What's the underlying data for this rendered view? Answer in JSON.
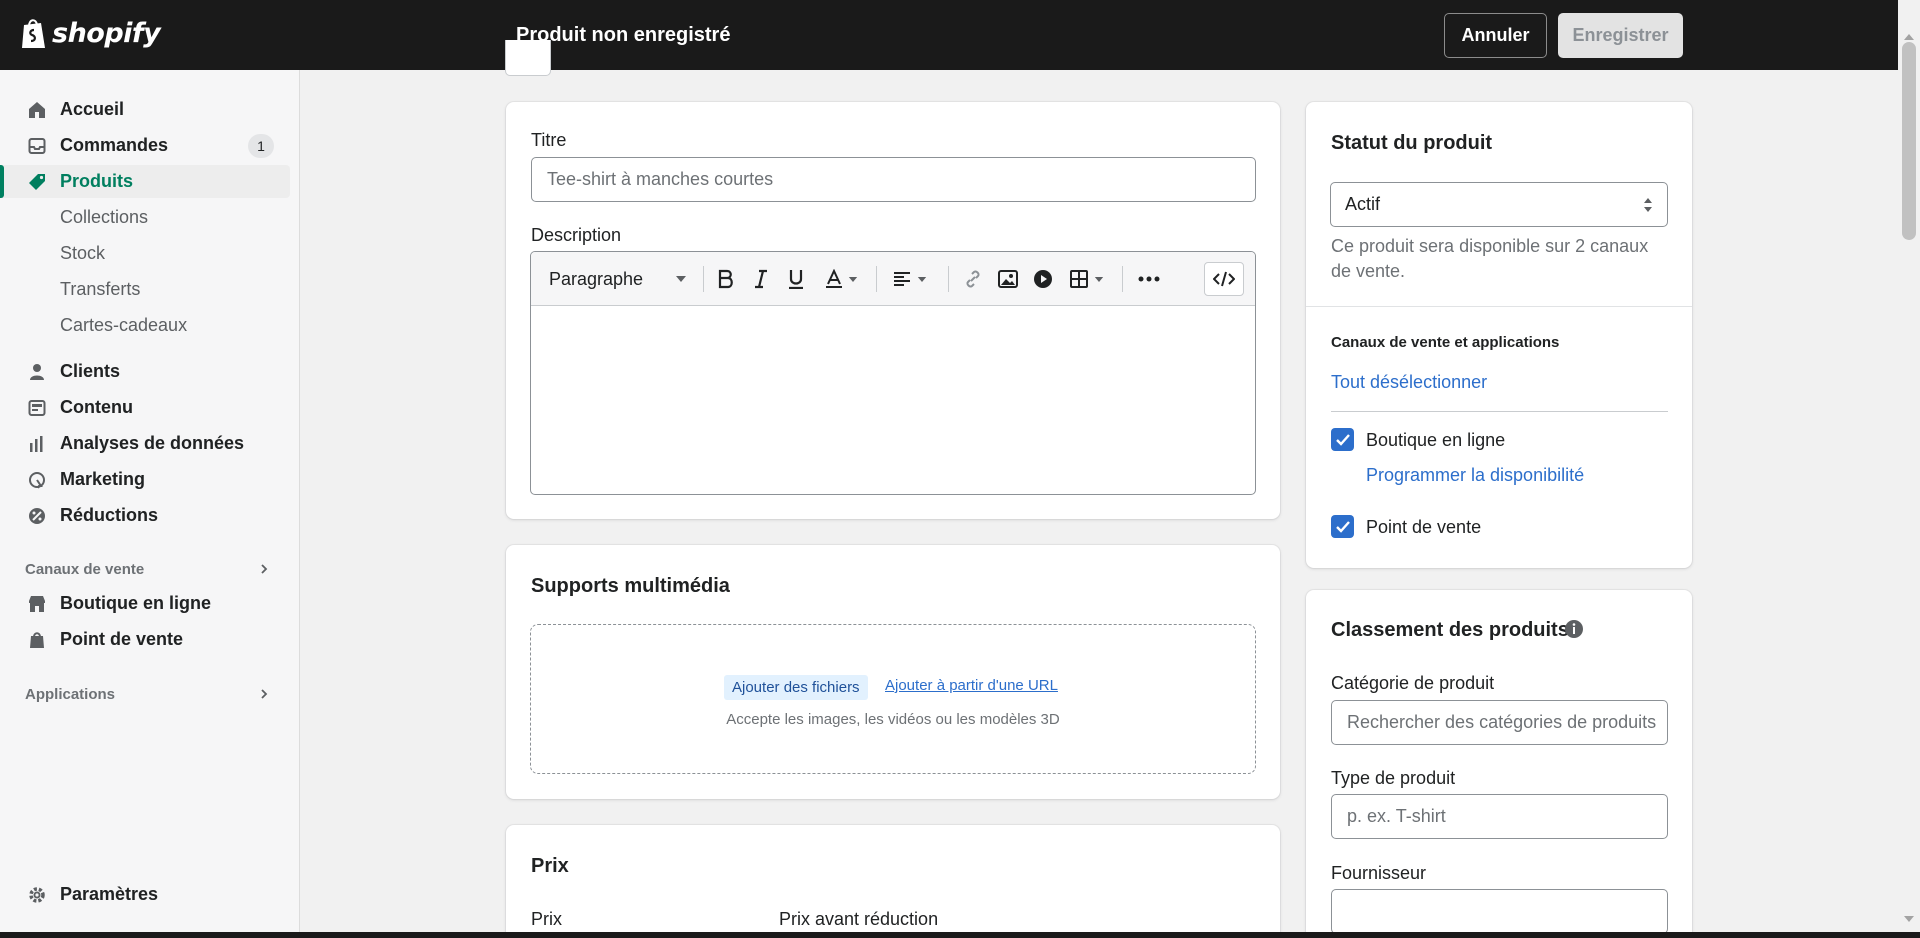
{
  "brand": {
    "name": "shopify",
    "accent": "#008060"
  },
  "header": {
    "title": "Produit non enregistré",
    "cancel_label": "Annuler",
    "save_label": "Enregistrer"
  },
  "sidebar": {
    "items": [
      {
        "label": "Accueil",
        "icon": "home-icon"
      },
      {
        "label": "Commandes",
        "icon": "inbox-icon",
        "badge": "1"
      },
      {
        "label": "Produits",
        "icon": "tag-icon",
        "active": true
      },
      {
        "label": "Collections"
      },
      {
        "label": "Stock"
      },
      {
        "label": "Transferts"
      },
      {
        "label": "Cartes-cadeaux"
      },
      {
        "label": "Clients",
        "icon": "person-icon"
      },
      {
        "label": "Contenu",
        "icon": "content-icon"
      },
      {
        "label": "Analyses de données",
        "icon": "analytics-icon"
      },
      {
        "label": "Marketing",
        "icon": "marketing-icon"
      },
      {
        "label": "Réductions",
        "icon": "discount-icon"
      }
    ],
    "sales_channels_label": "Canaux de vente",
    "channels": [
      {
        "label": "Boutique en ligne",
        "icon": "store-icon"
      },
      {
        "label": "Point de vente",
        "icon": "pos-bag-icon"
      }
    ],
    "apps_label": "Applications",
    "settings_label": "Paramètres"
  },
  "product": {
    "title_label": "Titre",
    "title_placeholder": "Tee-shirt à manches courtes",
    "description_label": "Description",
    "paragraph_select": "Paragraphe"
  },
  "media": {
    "title": "Supports multimédia",
    "add_files": "Ajouter des fichiers",
    "add_url": "Ajouter à partir d'une URL",
    "hint": "Accepte les images, les vidéos ou les modèles 3D"
  },
  "pricing": {
    "title": "Prix",
    "price_label": "Prix",
    "compare_label": "Prix avant réduction"
  },
  "status": {
    "title": "Statut du produit",
    "value": "Actif",
    "help": "Ce produit sera disponible sur 2 canaux de vente.",
    "channels_heading": "Canaux de vente et applications",
    "deselect_all": "Tout désélectionner",
    "channel_online": "Boutique en ligne",
    "schedule": "Programmer la disponibilité",
    "channel_pos": "Point de vente"
  },
  "organization": {
    "title": "Classement des produits",
    "category_label": "Catégorie de produit",
    "category_placeholder": "Rechercher des catégories de produits",
    "type_label": "Type de produit",
    "type_placeholder": "p. ex. T-shirt",
    "vendor_label": "Fournisseur"
  }
}
